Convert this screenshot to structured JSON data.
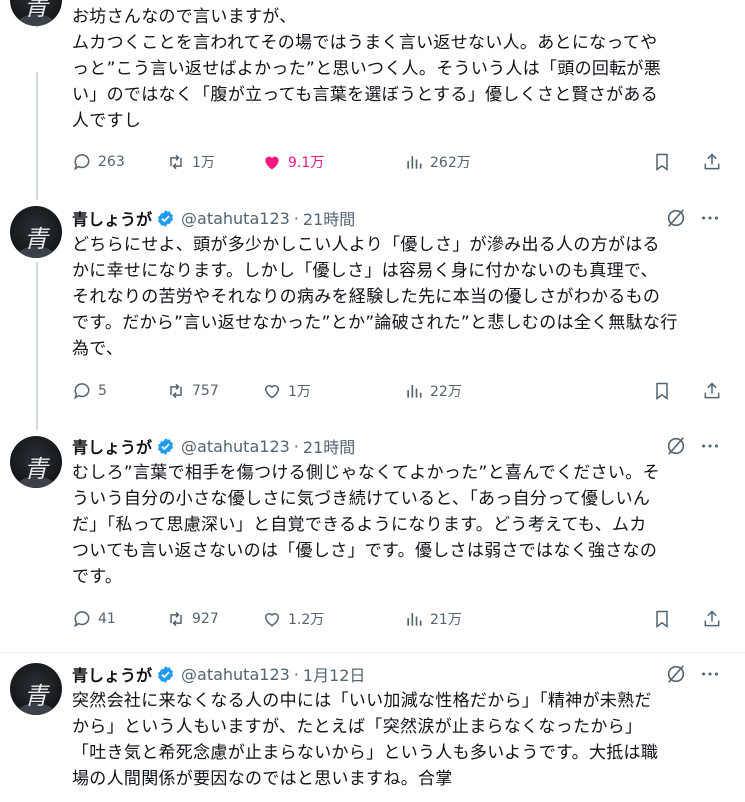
{
  "colors": {
    "text": "#0f1419",
    "muted": "#536471",
    "like": "#f91880",
    "verified": "#1d9bf0",
    "line": "#cfd9de"
  },
  "top_tweet": {
    "lines": [
      "お坊さんなので言いますが、",
      "ムカつくことを言われてその場ではうまく言い返せない人。あとになってや",
      "っと”こう言い返せばよかった”と思いつく人。そういう人は「頭の回転が悪",
      "い」のではなく「腹が立っても言葉を選ぼうとする」優しくさと賢さがある",
      "人ですし"
    ],
    "replies": "263",
    "retweets": "1万",
    "likes": "9.1万",
    "views": "262万",
    "liked": true
  },
  "tweets": [
    {
      "name": "青しょうが",
      "handle": "@atahuta123",
      "separator": "·",
      "time": "21時間",
      "lines": [
        "どちらにせよ、頭が多少かしこい人より「優しさ」が滲み出る人の方がはる",
        "かに幸せになります。しかし「優しさ」は容易く身に付かないのも真理で、",
        "それなりの苦労やそれなりの病みを経験した先に本当の優しさがわかるもの",
        "です。だから”言い返せなかった”とか”論破された”と悲しむのは全く無駄な行",
        "為で、"
      ],
      "replies": "5",
      "retweets": "757",
      "likes": "1万",
      "views": "22万"
    },
    {
      "name": "青しょうが",
      "handle": "@atahuta123",
      "separator": "·",
      "time": "21時間",
      "lines": [
        "むしろ”言葉で相手を傷つける側じゃなくてよかった”と喜んでください。そ",
        "ういう自分の小さな優しさに気づき続けていると、「あっ自分って優しいん",
        "だ」「私って思慮深い」と自覚できるようになります。どう考えても、ムカ",
        "ついても言い返さないのは「優しさ」です。優しさは弱さではなく強さなの",
        "です。"
      ],
      "replies": "41",
      "retweets": "927",
      "likes": "1.2万",
      "views": "21万"
    },
    {
      "name": "青しょうが",
      "handle": "@atahuta123",
      "separator": "·",
      "time": "1月12日",
      "lines": [
        "突然会社に来なくなる人の中には「いい加減な性格だから」「精神が未熟だ",
        "から」という人もいますが、たとえば「突然涙が止まらなくなったから」",
        "「吐き気と希死念慮が止まらないから」という人も多いようです。大抵は職",
        "場の人間関係が要因なのではと思いますね。合掌"
      ]
    }
  ],
  "avatar_glyph": "青",
  "icons": {
    "reply": "reply-icon",
    "retweet": "retweet-icon",
    "like": "heart-icon",
    "views": "views-icon",
    "bookmark": "bookmark-icon",
    "share": "share-icon",
    "grok": "grok-icon",
    "more": "more-icon",
    "verified": "verified-badge-icon"
  }
}
